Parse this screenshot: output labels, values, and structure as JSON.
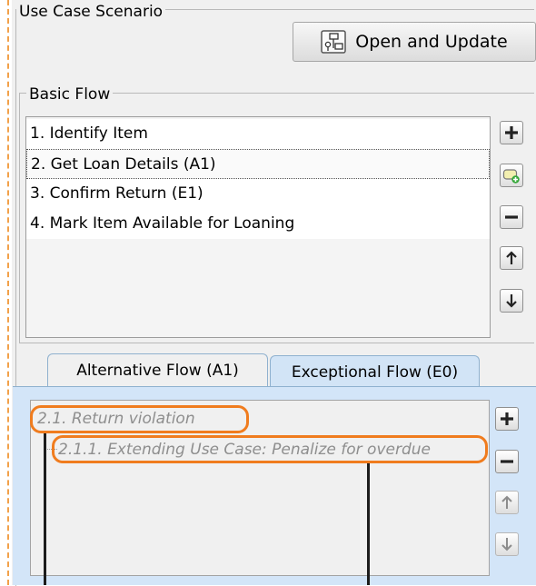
{
  "scenario": {
    "title": "Use Case Scenario",
    "open_button": {
      "label": "Open and Update",
      "icon": "diagram-icon"
    }
  },
  "basic_flow": {
    "title": "Basic Flow",
    "steps": [
      "1. Identify Item",
      "2. Get Loan Details (A1)",
      "3. Confirm Return (E1)",
      "4. Mark Item Available for Loaning"
    ],
    "selected_index": 1,
    "buttons": [
      "add-icon",
      "add-alternative-icon",
      "remove-icon",
      "move-up-icon",
      "move-down-icon"
    ]
  },
  "tabs": [
    {
      "label": "Alternative Flow (A1)",
      "active": true
    },
    {
      "label": "Exceptional Flow (E0)",
      "active": false
    }
  ],
  "alternative_flow": {
    "items": [
      "2.1. Return violation",
      "2.1.1. Extending Use Case: Penalize for overdue"
    ],
    "buttons": [
      "add-icon",
      "remove-icon",
      "move-up-icon",
      "move-down-icon"
    ]
  },
  "colors": {
    "highlight": "#f07c1e",
    "tab_panel": "#d3e5f8",
    "frame_dash": "#f2a14a"
  }
}
